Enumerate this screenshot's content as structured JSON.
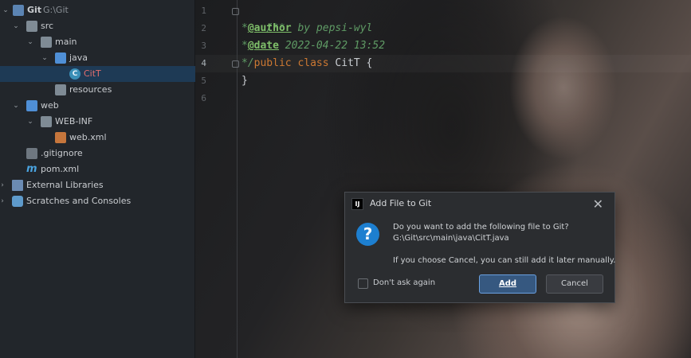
{
  "project": {
    "rows": [
      {
        "label": "Git",
        "sub": "G:\\Git"
      },
      {
        "label": "src"
      },
      {
        "label": "main"
      },
      {
        "label": "java"
      },
      {
        "label": "CitT"
      },
      {
        "label": "resources"
      },
      {
        "label": "web"
      },
      {
        "label": "WEB-INF"
      },
      {
        "label": "web.xml"
      },
      {
        "label": ".gitignore"
      },
      {
        "label": "pom.xml"
      },
      {
        "label": "External Libraries"
      },
      {
        "label": "Scratches and Consoles"
      }
    ]
  },
  "editor": {
    "line_numbers": [
      "1",
      "2",
      "3",
      "4",
      "5",
      "6"
    ],
    "current_line": "4",
    "code": {
      "l1": "/**",
      "l2_star": "*",
      "l2_tag": "@author",
      "l2_text": " by pepsi-wyl",
      "l3_star": "*",
      "l3_tag": "@date",
      "l3_text": " 2022-04-22 13:52",
      "l4_cmt": "*/",
      "l4_kw1": "public",
      "l4_kw2": "class",
      "l4_name": " CitT {",
      "l5": "}"
    }
  },
  "dialog": {
    "title": "Add File to Git",
    "question": "Do you want to add the following file to Git?",
    "path": "G:\\Git\\src\\main\\java\\CitT.java",
    "note": "If you choose Cancel, you can still add it later manually.",
    "checkbox_label": "Don't ask again",
    "add_label": "Add",
    "cancel_label": "Cancel",
    "app_icon_text": "IJ",
    "question_icon": "?"
  },
  "colors": {
    "accent": "#365880",
    "selection": "#1e3a55",
    "comment": "#5f9b65",
    "keyword": "#cc7832"
  }
}
